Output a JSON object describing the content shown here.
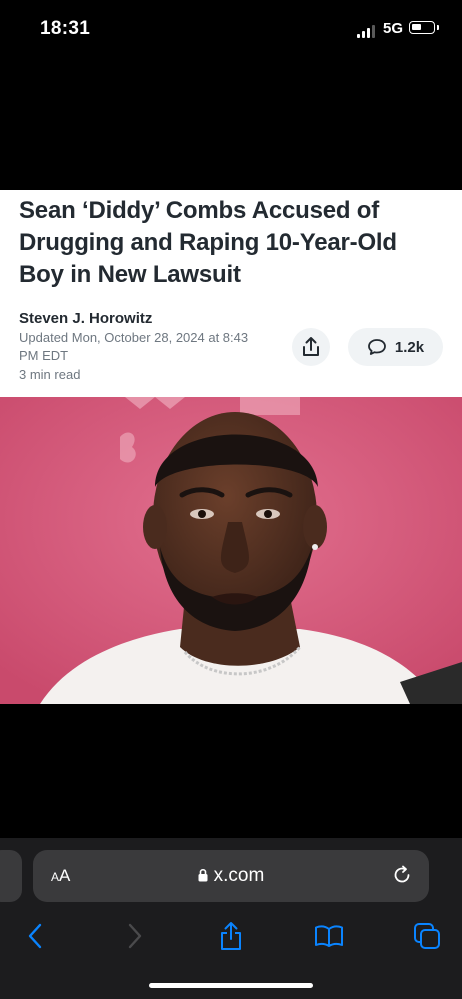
{
  "status_bar": {
    "time": "18:31",
    "network": "5G",
    "signal_bars": 3,
    "battery_level": 0.35
  },
  "article": {
    "headline": "Sean ‘Diddy’ Combs Accused of Drugging and Raping 10-Year-Old Boy in New Lawsuit",
    "author": "Steven J. Horowitz",
    "updated": "Updated Mon, October 28, 2024 at 8:43 PM EDT",
    "read_time": "3 min read",
    "comment_count": "1.2k",
    "icons": {
      "share": "share-icon",
      "comment": "comment-bubble-icon"
    }
  },
  "photo": {
    "icon": "article-photo",
    "accent_color": "#d65778"
  },
  "browser": {
    "text_size_label_big": "A",
    "text_size_label_small": "A",
    "url": "x.com",
    "icons": [
      "lock-icon",
      "reload-icon",
      "back-icon",
      "forward-icon",
      "share-icon",
      "bookmarks-icon",
      "tabs-icon"
    ],
    "accent_color": "#0a84ff"
  }
}
